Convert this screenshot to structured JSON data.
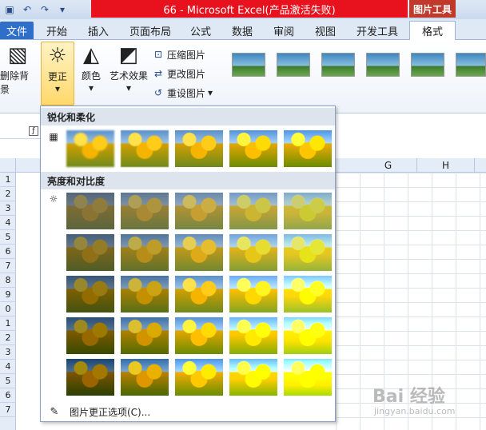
{
  "window": {
    "title": "66 - Microsoft Excel(产品激活失败)",
    "context_tab_label": "图片工具"
  },
  "tabs": [
    "文件",
    "开始",
    "插入",
    "页面布局",
    "公式",
    "数据",
    "审阅",
    "视图",
    "开发工具",
    "格式"
  ],
  "ribbon": {
    "remove_bg_label": "删除背景",
    "correct_label": "更正",
    "color_label": "颜色",
    "art_effects_label": "艺术效果",
    "compress_label": "压缩图片",
    "change_label": "更改图片",
    "reset_label": "重设图片"
  },
  "columns": [
    "G",
    "H"
  ],
  "rows": [
    "1",
    "2",
    "3",
    "4",
    "5",
    "6",
    "7",
    "8",
    "9",
    "0",
    "1",
    "2",
    "3",
    "4",
    "5",
    "6",
    "7"
  ],
  "dropdown": {
    "section1_title": "锐化和柔化",
    "section2_title": "亮度和对比度",
    "more_options_label": "图片更正选项(C)..."
  },
  "watermark": {
    "text": "Bai 经验",
    "sub": "jingyan.baidu.com"
  }
}
